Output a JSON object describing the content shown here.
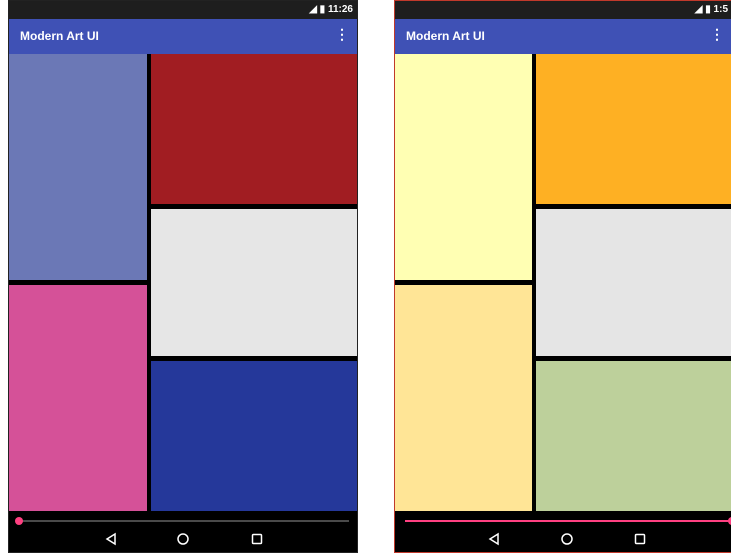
{
  "left_screen": {
    "status_time": "11:26",
    "app_title": "Modern Art UI",
    "seek_progress": 0.0,
    "blocks": [
      {
        "name": "block-top-left",
        "color": "#6b78b6"
      },
      {
        "name": "block-bottom-left",
        "color": "#d55198"
      },
      {
        "name": "block-top-right",
        "color": "#a11d22"
      },
      {
        "name": "block-middle-right",
        "color": "#e6e6e6"
      },
      {
        "name": "block-bottom-right",
        "color": "#25389a"
      }
    ]
  },
  "right_screen": {
    "status_time": "1:5",
    "app_title": "Modern Art UI",
    "seek_progress": 1.0,
    "blocks": [
      {
        "name": "block-top-left",
        "color": "#ffffb3"
      },
      {
        "name": "block-bottom-left",
        "color": "#ffe596"
      },
      {
        "name": "block-top-right",
        "color": "#feb023"
      },
      {
        "name": "block-middle-right",
        "color": "#e5e5e5"
      },
      {
        "name": "block-bottom-right",
        "color": "#bdd09b"
      }
    ]
  },
  "colors": {
    "app_bar": "#3f51b5",
    "accent": "#ff4081",
    "status_bar": "#1e1e1e"
  }
}
